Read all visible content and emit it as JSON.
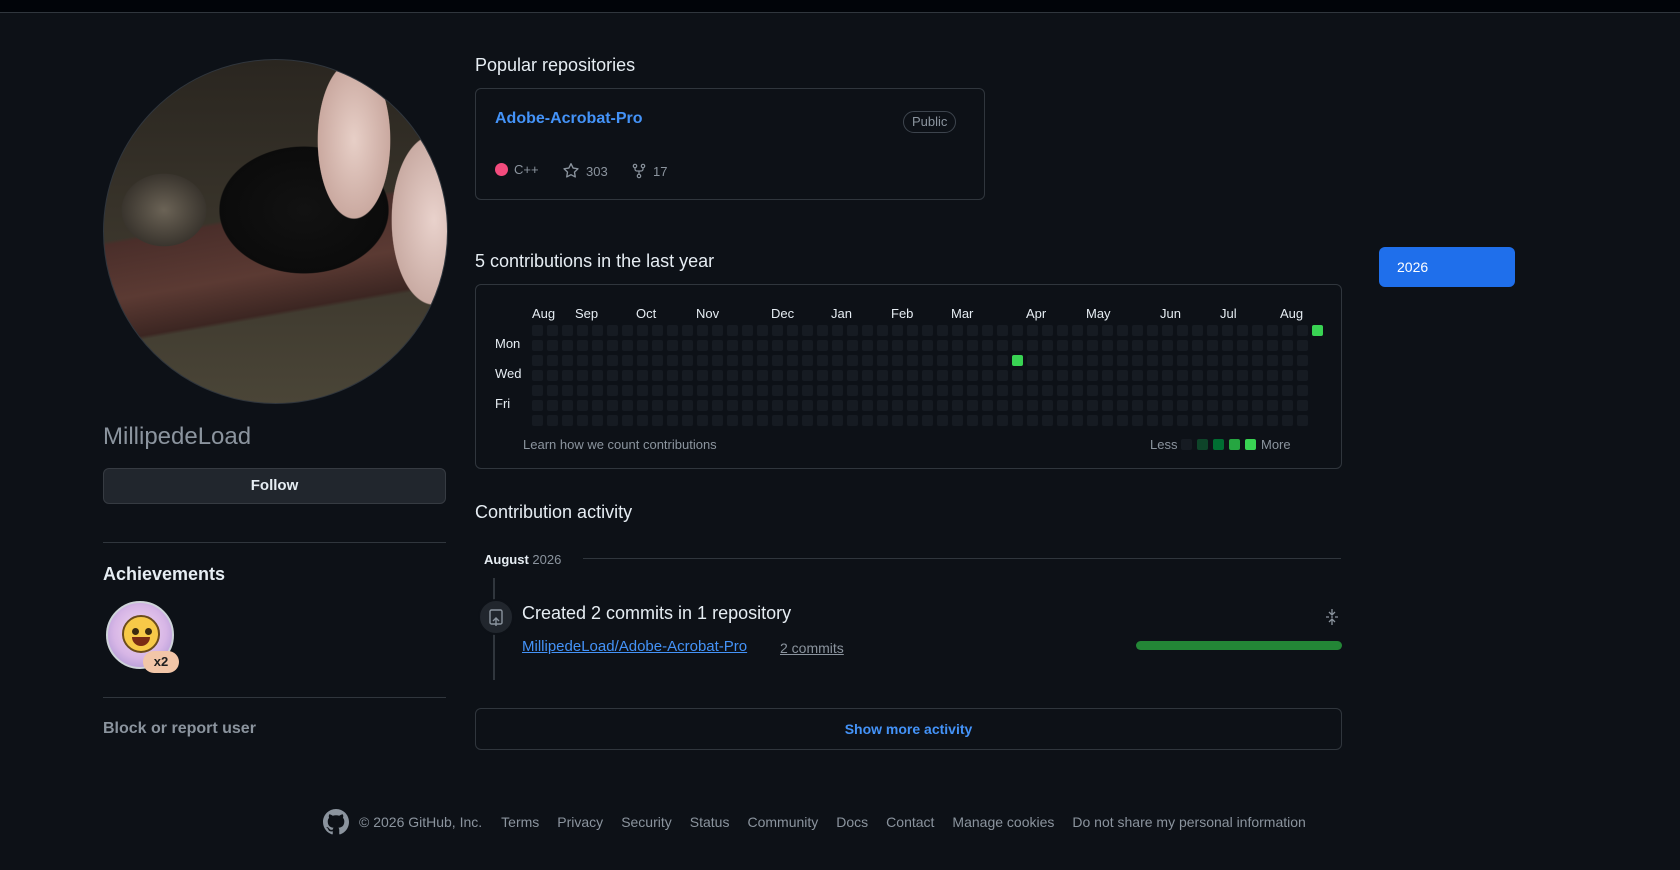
{
  "profile": {
    "username": "MillipedeLoad",
    "follow_label": "Follow",
    "achievements_title": "Achievements",
    "badge_count": "x2",
    "block_label": "Block or report user",
    "avatar_icon": "profile-photo"
  },
  "popular": {
    "title": "Popular repositories",
    "repo": {
      "name": "Adobe-Acrobat-Pro",
      "visibility": "Public",
      "language": "C++",
      "language_color": "#f34b7d",
      "stars": "303",
      "forks": "17"
    }
  },
  "contributions": {
    "title": "5 contributions in the last year",
    "months": [
      "Aug",
      "Sep",
      "Oct",
      "Nov",
      "Dec",
      "Jan",
      "Feb",
      "Mar",
      "Apr",
      "May",
      "Jun",
      "Jul",
      "Aug"
    ],
    "days": [
      "Mon",
      "Wed",
      "Fri"
    ],
    "learn_label": "Learn how we count contributions",
    "less_label": "Less",
    "more_label": "More",
    "colors": [
      "#161b22",
      "#0e4429",
      "#006d32",
      "#26a641",
      "#39d353"
    ]
  },
  "activity": {
    "title": "Contribution activity",
    "month": "August",
    "year": "2026",
    "commit_title": "Created 2 commits in 1 repository",
    "repo": "MillipedeLoad/Adobe-Acrobat-Pro",
    "commits": "2 commits",
    "show_more": "Show more activity"
  },
  "year_selector": {
    "selected": "2026"
  },
  "footer": {
    "copyright": "© 2026 GitHub, Inc.",
    "links": [
      "Terms",
      "Privacy",
      "Security",
      "Status",
      "Community",
      "Docs",
      "Contact",
      "Manage cookies",
      "Do not share my personal information"
    ]
  }
}
